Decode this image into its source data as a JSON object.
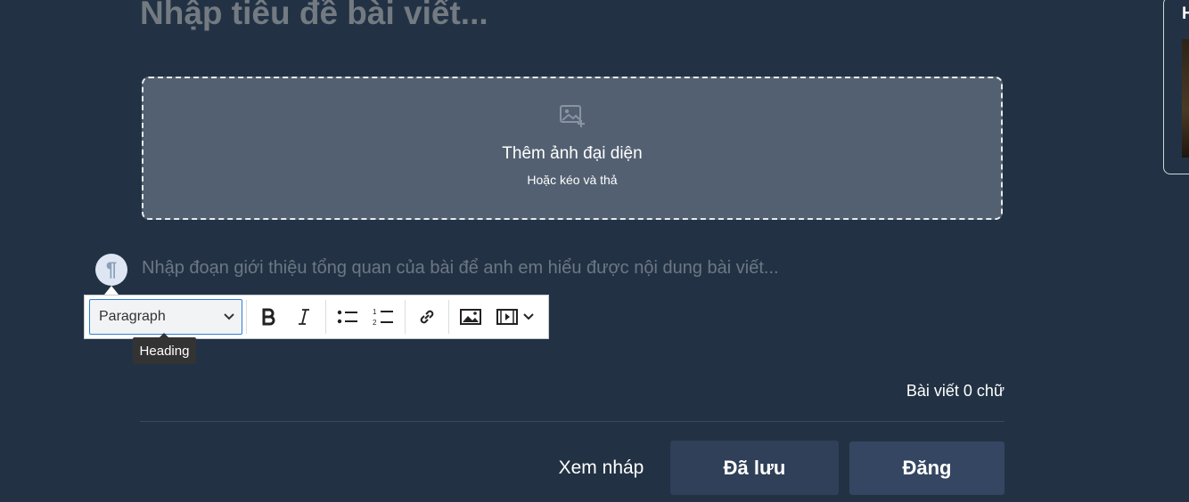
{
  "editor": {
    "title_placeholder": "Nhập tiêu đề bài viết...",
    "cover": {
      "icon": "add-image-icon",
      "label": "Thêm ảnh đại diện",
      "sub_label": "Hoặc kéo và thả"
    },
    "paragraph_handle": "¶",
    "intro_placeholder": "Nhập đoạn giới thiệu tổng quan của bài để anh em hiểu được nội dung bài viết...",
    "toolbar": {
      "block_type": "Paragraph",
      "tooltip": "Heading",
      "buttons": [
        "bold-icon",
        "italic-icon",
        "bulleted-list-icon",
        "numbered-list-icon",
        "link-icon",
        "image-icon",
        "media-embed-icon"
      ]
    },
    "word_count": "Bài viết 0 chữ"
  },
  "actions": {
    "preview_label": "Xem nháp",
    "saved_label": "Đã lưu",
    "publish_label": "Đăng"
  },
  "side_panel": {
    "heading_initial": "H"
  },
  "colors": {
    "background": "#223244",
    "upload_bg": "#536071",
    "button_bg": "#2f4058",
    "select_border": "#2f7fd8"
  }
}
